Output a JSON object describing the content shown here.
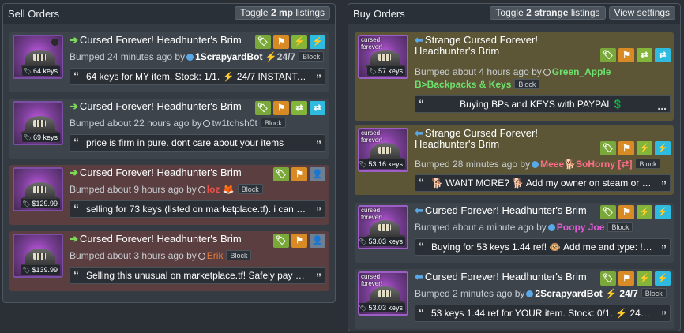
{
  "sell_panel": {
    "title": "Sell Orders",
    "toggle": {
      "prefix": "Toggle",
      "count": "2 mp",
      "suffix": "listings"
    },
    "listings": [
      {
        "title": "Cursed Forever! Headhunter's Brim",
        "price": "64 keys",
        "bumped": "Bumped 24 minutes ago by",
        "user": "1ScrapyardBot",
        "user_suffix": "24/7",
        "user_color": "#ffffff",
        "comment": "64 keys for MY item. Stock: 1/1. ⚡ 24/7 INSTANT. 5..."
      },
      {
        "title": "Cursed Forever! Headhunter's Brim",
        "price": "69 keys",
        "bumped": "Bumped about 22 hours ago by",
        "user": "tw1tchsh0t",
        "user_suffix": "",
        "user_color": "#c8cdd2",
        "comment": "price is firm in pure. dont care about your items"
      },
      {
        "title": "Cursed Forever! Headhunter's Brim",
        "price": "$129.99",
        "bumped": "Bumped about 9 hours ago by",
        "user": "loz",
        "user_suffix": "🦊",
        "user_color": "#e8534a",
        "comment": "selling for 73 keys (listed on marketplace.tf). i can u..."
      },
      {
        "title": "Cursed Forever! Headhunter's Brim",
        "price": "$139.99",
        "bumped": "Bumped about 3 hours ago by",
        "user": "Erik",
        "user_suffix": "",
        "user_color": "#e07b39",
        "comment": "Selling this unusual on marketplace.tf! Safely pay wit..."
      }
    ]
  },
  "buy_panel": {
    "title": "Buy Orders",
    "toggle": {
      "prefix": "Toggle",
      "count": "2 strange",
      "suffix": "listings"
    },
    "view_settings": "View settings",
    "listings": [
      {
        "caption": "cursed forever!",
        "title": "Strange Cursed Forever! Headhunter's Brim",
        "price": "57 keys",
        "bumped": "Bumped about 4 hours ago by",
        "user": "Green_Apple B>Backpacks & Keys",
        "user_color": "#6ee06e",
        "comment": "Buying BPs and KEYS with PAYPAL💲"
      },
      {
        "caption": "cursed forever!",
        "title": "Strange Cursed Forever! Headhunter's Brim",
        "price": "53.16 keys",
        "bumped": "Bumped 28 minutes ago by",
        "user": "Meee🐕SoHorny [⇄]",
        "user_color": "#ff6b8a",
        "comment": "🐕 WANT MORE? 🐕 Add my owner on steam or dis..."
      },
      {
        "caption": "cursed forever!",
        "title": "Cursed Forever! Headhunter's Brim",
        "price": "53.03 keys",
        "bumped": "Bumped about a minute ago by",
        "user": "Poopy Joe",
        "user_color": "#e05ad6",
        "comment": "Buying for 53 keys 1.44 ref! 🐵 Add me and type: !se..."
      },
      {
        "caption": "cursed forever!",
        "title": "Cursed Forever! Headhunter's Brim",
        "price": "53.03 keys",
        "bumped": "Bumped 2 minutes ago by",
        "user": "2ScrapyardBot ⚡ 24/7",
        "user_color": "#ffffff",
        "comment": "53 keys 1.44 ref for YOUR item. Stock: 0/1. ⚡ 24/7 I..."
      }
    ]
  },
  "common": {
    "block_label": "Block"
  },
  "colors": {
    "accent_green": "#7ed957",
    "accent_blue": "#5aa9e6",
    "quality_purple": "#7a4fa5"
  }
}
